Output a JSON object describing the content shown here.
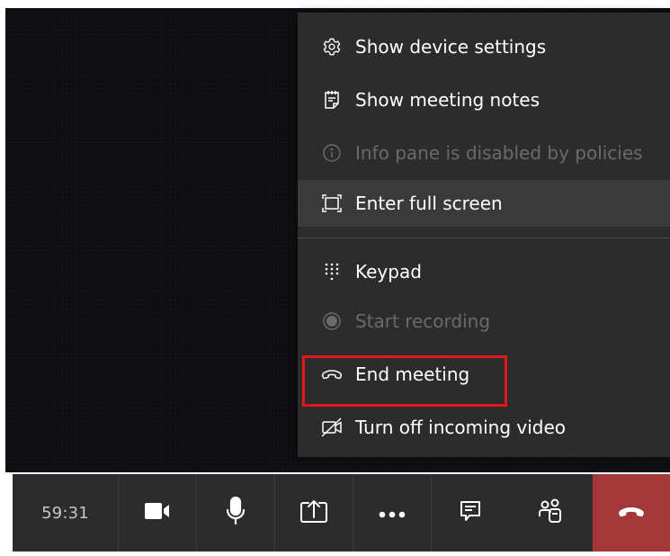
{
  "menu": {
    "items": [
      {
        "id": "device-settings",
        "label": "Show device settings",
        "icon": "gear-icon",
        "enabled": true,
        "highlighted": false
      },
      {
        "id": "meeting-notes",
        "label": "Show meeting notes",
        "icon": "notes-icon",
        "enabled": true,
        "highlighted": false
      },
      {
        "id": "info-pane",
        "label": "Info pane is disabled by policies",
        "icon": "info-icon",
        "enabled": false,
        "highlighted": false
      },
      {
        "id": "full-screen",
        "label": "Enter full screen",
        "icon": "fullscreen-icon",
        "enabled": true,
        "highlighted": true
      },
      {
        "id": "keypad",
        "label": "Keypad",
        "icon": "keypad-icon",
        "enabled": true,
        "highlighted": false
      },
      {
        "id": "start-recording",
        "label": "Start recording",
        "icon": "record-icon",
        "enabled": false,
        "highlighted": false
      },
      {
        "id": "end-meeting",
        "label": "End meeting",
        "icon": "end-call-icon",
        "enabled": true,
        "highlighted": false,
        "outlined": true
      },
      {
        "id": "incoming-video",
        "label": "Turn off incoming video",
        "icon": "video-off-icon",
        "enabled": true,
        "highlighted": false
      }
    ]
  },
  "call_bar": {
    "timer": "59:31",
    "buttons": [
      {
        "id": "camera",
        "icon": "camera-icon"
      },
      {
        "id": "microphone",
        "icon": "microphone-icon"
      },
      {
        "id": "share",
        "icon": "share-screen-icon"
      },
      {
        "id": "more",
        "icon": "more-options-icon"
      },
      {
        "id": "chat",
        "icon": "chat-icon"
      },
      {
        "id": "participants",
        "icon": "participants-icon"
      },
      {
        "id": "hangup",
        "icon": "hang-up-icon"
      }
    ]
  },
  "colors": {
    "menu_background": "#2d2c2c",
    "menu_highlight": "#3b3a3a",
    "disabled_text": "#6a6a6a",
    "annotation_outline": "#e21818",
    "hangup_button": "#a4373a",
    "video_background": "#0d0c11"
  }
}
